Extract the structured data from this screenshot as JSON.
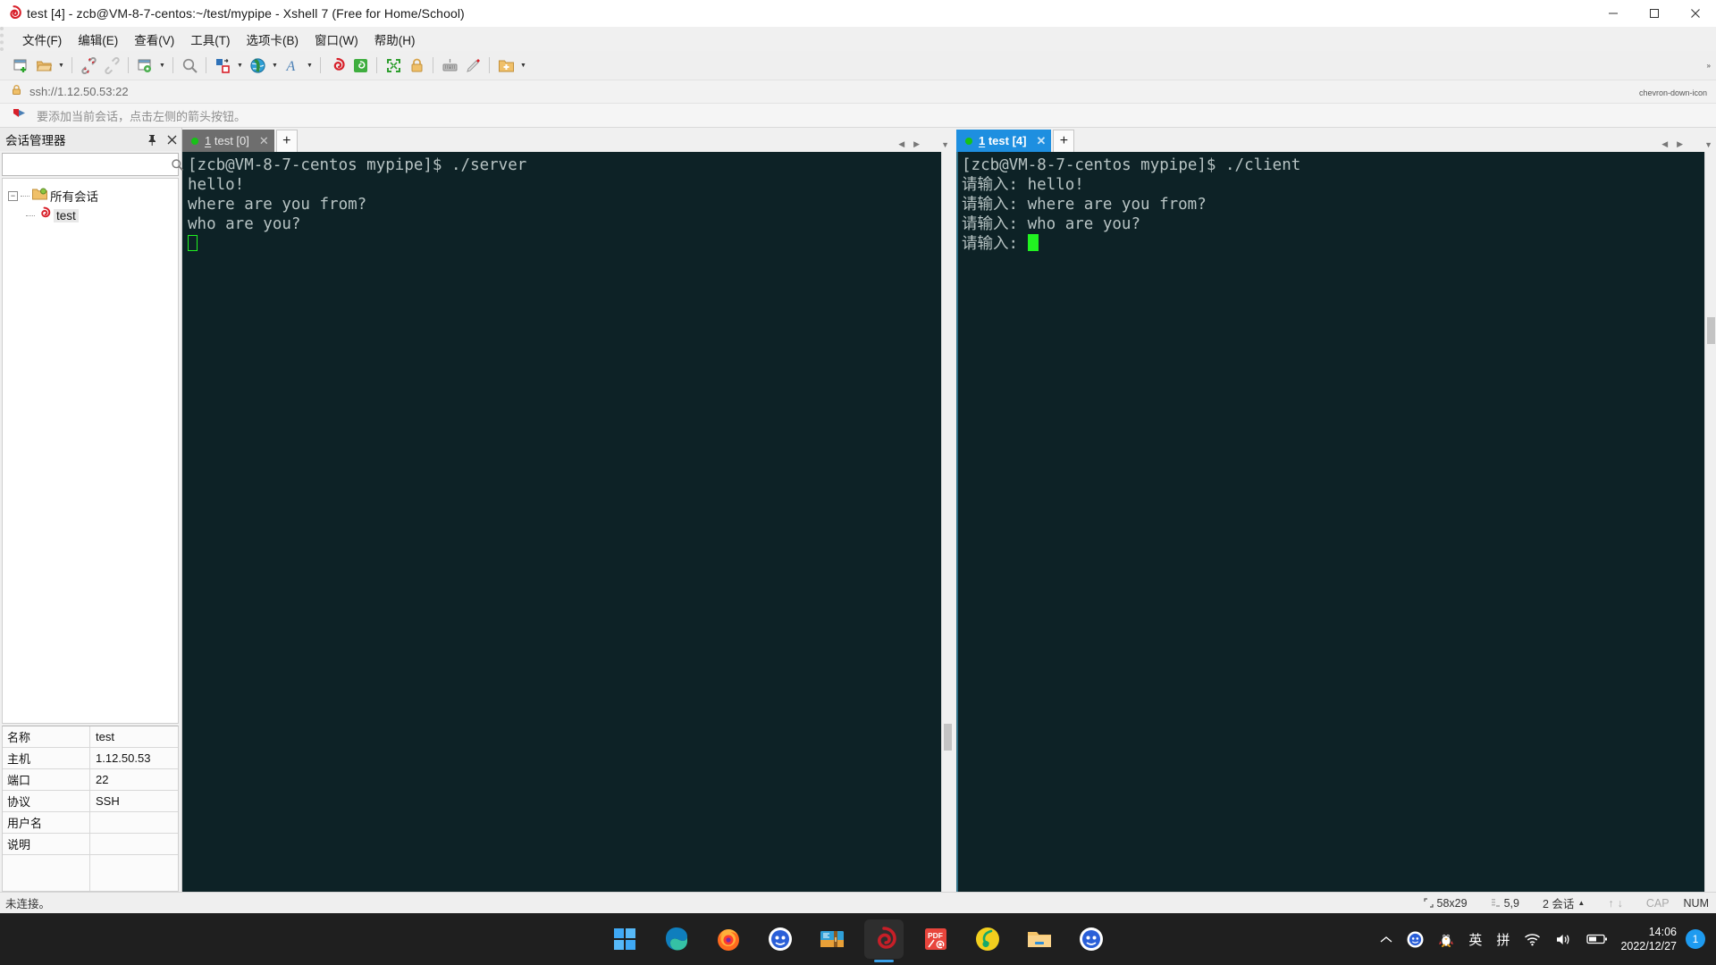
{
  "window": {
    "title": "test [4] - zcb@VM-8-7-centos:~/test/mypipe - Xshell 7 (Free for Home/School)",
    "app_icon": "xshell-spiral-icon",
    "minimize_label": "–",
    "maximize_label": "□",
    "close_label": "✕"
  },
  "menubar": {
    "items": [
      {
        "label": "文件(F)",
        "name": "menu-file"
      },
      {
        "label": "编辑(E)",
        "name": "menu-edit"
      },
      {
        "label": "查看(V)",
        "name": "menu-view"
      },
      {
        "label": "工具(T)",
        "name": "menu-tools"
      },
      {
        "label": "选项卡(B)",
        "name": "menu-tabs"
      },
      {
        "label": "窗口(W)",
        "name": "menu-window"
      },
      {
        "label": "帮助(H)",
        "name": "menu-help"
      }
    ]
  },
  "toolbar": {
    "overflow_label": "»",
    "buttons": [
      {
        "icon": "new-session-icon",
        "caret": false
      },
      {
        "icon": "open-folder-icon",
        "caret": true
      },
      {
        "sep": true
      },
      {
        "icon": "disconnect-icon",
        "caret": false
      },
      {
        "icon": "reconnect-icon",
        "caret": false
      },
      {
        "sep": true
      },
      {
        "icon": "properties-gear-icon",
        "caret": true
      },
      {
        "sep": true
      },
      {
        "icon": "find-search-icon",
        "caret": false
      },
      {
        "sep": true
      },
      {
        "icon": "file-transfer-icon",
        "caret": true
      },
      {
        "icon": "globe-icon",
        "caret": true
      },
      {
        "icon": "font-icon",
        "caret": true
      },
      {
        "sep": true
      },
      {
        "icon": "xshell-icon",
        "caret": false
      },
      {
        "icon": "xftp-icon",
        "caret": false
      },
      {
        "sep": true
      },
      {
        "icon": "fullscreen-icon",
        "caret": false
      },
      {
        "icon": "lock-icon",
        "caret": false
      },
      {
        "sep": true
      },
      {
        "icon": "keyboard-icon",
        "caret": false
      },
      {
        "icon": "highlight-pen-icon",
        "caret": false
      },
      {
        "sep": true
      },
      {
        "icon": "add-folder-icon",
        "caret": true
      }
    ]
  },
  "address_bar": {
    "lock_icon": "lock-icon",
    "url": "ssh://1.12.50.53:22",
    "dropdown_icon": "chevron-down-icon"
  },
  "hint_bar": {
    "arrow_icon": "red-arrow-icon",
    "text": "要添加当前会话，点击左侧的箭头按钮。"
  },
  "sidebar": {
    "title": "会话管理器",
    "pin_icon": "pin-icon",
    "close_icon": "close-icon",
    "search": {
      "value": "",
      "placeholder": "",
      "icon": "search-icon"
    },
    "tree": {
      "root": {
        "label": "所有会话",
        "icon": "folder-sessions-icon",
        "expanded": true,
        "toggle": "−"
      },
      "children": [
        {
          "label": "test",
          "icon": "session-icon",
          "selected": true
        }
      ]
    },
    "properties": [
      {
        "key": "名称",
        "value": "test"
      },
      {
        "key": "主机",
        "value": "1.12.50.53"
      },
      {
        "key": "端口",
        "value": "22"
      },
      {
        "key": "协议",
        "value": "SSH"
      },
      {
        "key": "用户名",
        "value": ""
      },
      {
        "key": "说明",
        "value": ""
      },
      {
        "key": "",
        "value": ""
      }
    ]
  },
  "panes": {
    "left": {
      "tab": {
        "index": "1",
        "label": " test [0]",
        "close": "✕",
        "active": false,
        "status_dot_color": "#17c217"
      },
      "add_tab_label": "+",
      "nav_left": "◀",
      "nav_right": "▶",
      "nav_menu": "▼",
      "lines": [
        "[zcb@VM-8-7-centos mypipe]$ ./server",
        "hello!",
        "where are you from?",
        "who are you?"
      ],
      "cursor": "hollow"
    },
    "right": {
      "tab": {
        "index": "1",
        "label": " test [4]",
        "close": "✕",
        "active": true,
        "status_dot_color": "#17c217"
      },
      "add_tab_label": "+",
      "nav_left": "◀",
      "nav_right": "▶",
      "nav_menu": "▼",
      "lines": [
        "[zcb@VM-8-7-centos mypipe]$ ./client",
        "请输入: hello!",
        "请输入: where are you from?",
        "请输入: who are you?",
        "请输入: "
      ],
      "cursor": "solid"
    }
  },
  "statusbar": {
    "connection_state": "未连接。",
    "size_icon": "resize-icon",
    "size": "58x29",
    "position_icon": "cursor-pos-icon",
    "position": "5,9",
    "sessions": "2 会话",
    "sessions_caret": "▲",
    "up_icon": "↑",
    "down_icon": "↓",
    "caps": "CAP",
    "num": "NUM"
  },
  "taskbar": {
    "apps": [
      {
        "name": "start-windows-icon",
        "running": false,
        "active": false
      },
      {
        "name": "edge-browser-icon",
        "running": true,
        "active": false
      },
      {
        "name": "firefox-browser-icon",
        "running": true,
        "active": false
      },
      {
        "name": "tim-messenger-icon",
        "running": true,
        "active": false
      },
      {
        "name": "winrar-archiver-icon",
        "running": true,
        "active": false
      },
      {
        "name": "xshell-icon",
        "running": true,
        "active": true
      },
      {
        "name": "pdf-reader-icon",
        "running": true,
        "active": false
      },
      {
        "name": "netease-music-icon",
        "running": true,
        "active": false
      },
      {
        "name": "file-explorer-icon",
        "running": true,
        "active": false
      },
      {
        "name": "tim-second-icon",
        "running": true,
        "active": false
      }
    ],
    "tray": {
      "expand_icon": "chevron-up-icon",
      "items": [
        {
          "name": "tim-tray-icon",
          "glyph": ""
        },
        {
          "name": "qq-penguin-icon",
          "glyph": ""
        },
        {
          "name": "ime-chinese-icon",
          "glyph": "英"
        },
        {
          "name": "ime-pinyin-icon",
          "glyph": "拼"
        },
        {
          "name": "wifi-icon",
          "glyph": ""
        },
        {
          "name": "volume-icon",
          "glyph": ""
        },
        {
          "name": "battery-icon",
          "glyph": ""
        }
      ],
      "clock_time": "14:06",
      "clock_date": "2022/12/27",
      "notification_count": "1"
    }
  }
}
